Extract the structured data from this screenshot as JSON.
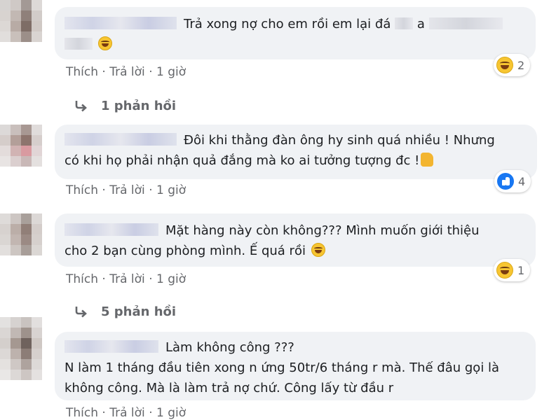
{
  "comments": [
    {
      "text_line1": "Trả xong nợ cho em rồi em lại đá",
      "text_a": "a",
      "like_label": "Thích",
      "reply_label": "Trả lời",
      "time": "1 giờ",
      "reaction_count": "2",
      "reaction_type": "haha-icon",
      "replies_label": "1 phản hồi"
    },
    {
      "text_line1": "Đôi khi thằng đàn ông hy sinh quá nhiều ! Nhưng",
      "text_line2": "có khi họ phải nhận quả đắng mà ko ai tưởng tượng đc !",
      "like_label": "Thích",
      "reply_label": "Trả lời",
      "time": "1 giờ",
      "reaction_count": "4",
      "reaction_type": "like-icon"
    },
    {
      "text_line1": "Mặt hàng này còn không??? Mình muốn giới thiệu",
      "text_line2": "cho 2 bạn cùng phòng mình. Ế quá rồi",
      "like_label": "Thích",
      "reply_label": "Trả lời",
      "time": "1 giờ",
      "reaction_count": "1",
      "reaction_type": "haha-icon",
      "replies_label": "5 phản hồi"
    },
    {
      "text_line1": "Làm không công ???",
      "text_line2": "N làm 1 tháng đầu tiên xong n ứng 50tr/6 tháng r mà. Thế đâu gọi là",
      "text_line3": "không công. Mà là làm trả nợ chứ. Công lấy từ đầu r",
      "like_label": "Thích",
      "reply_label": "Trả lời",
      "time": "1 giờ"
    }
  ],
  "separator": "·",
  "colors": {
    "bubble": "#f0f2f5",
    "meta_text": "#65676b",
    "like_blue": "#1877f2",
    "haha_yellow": "#f7c531"
  }
}
